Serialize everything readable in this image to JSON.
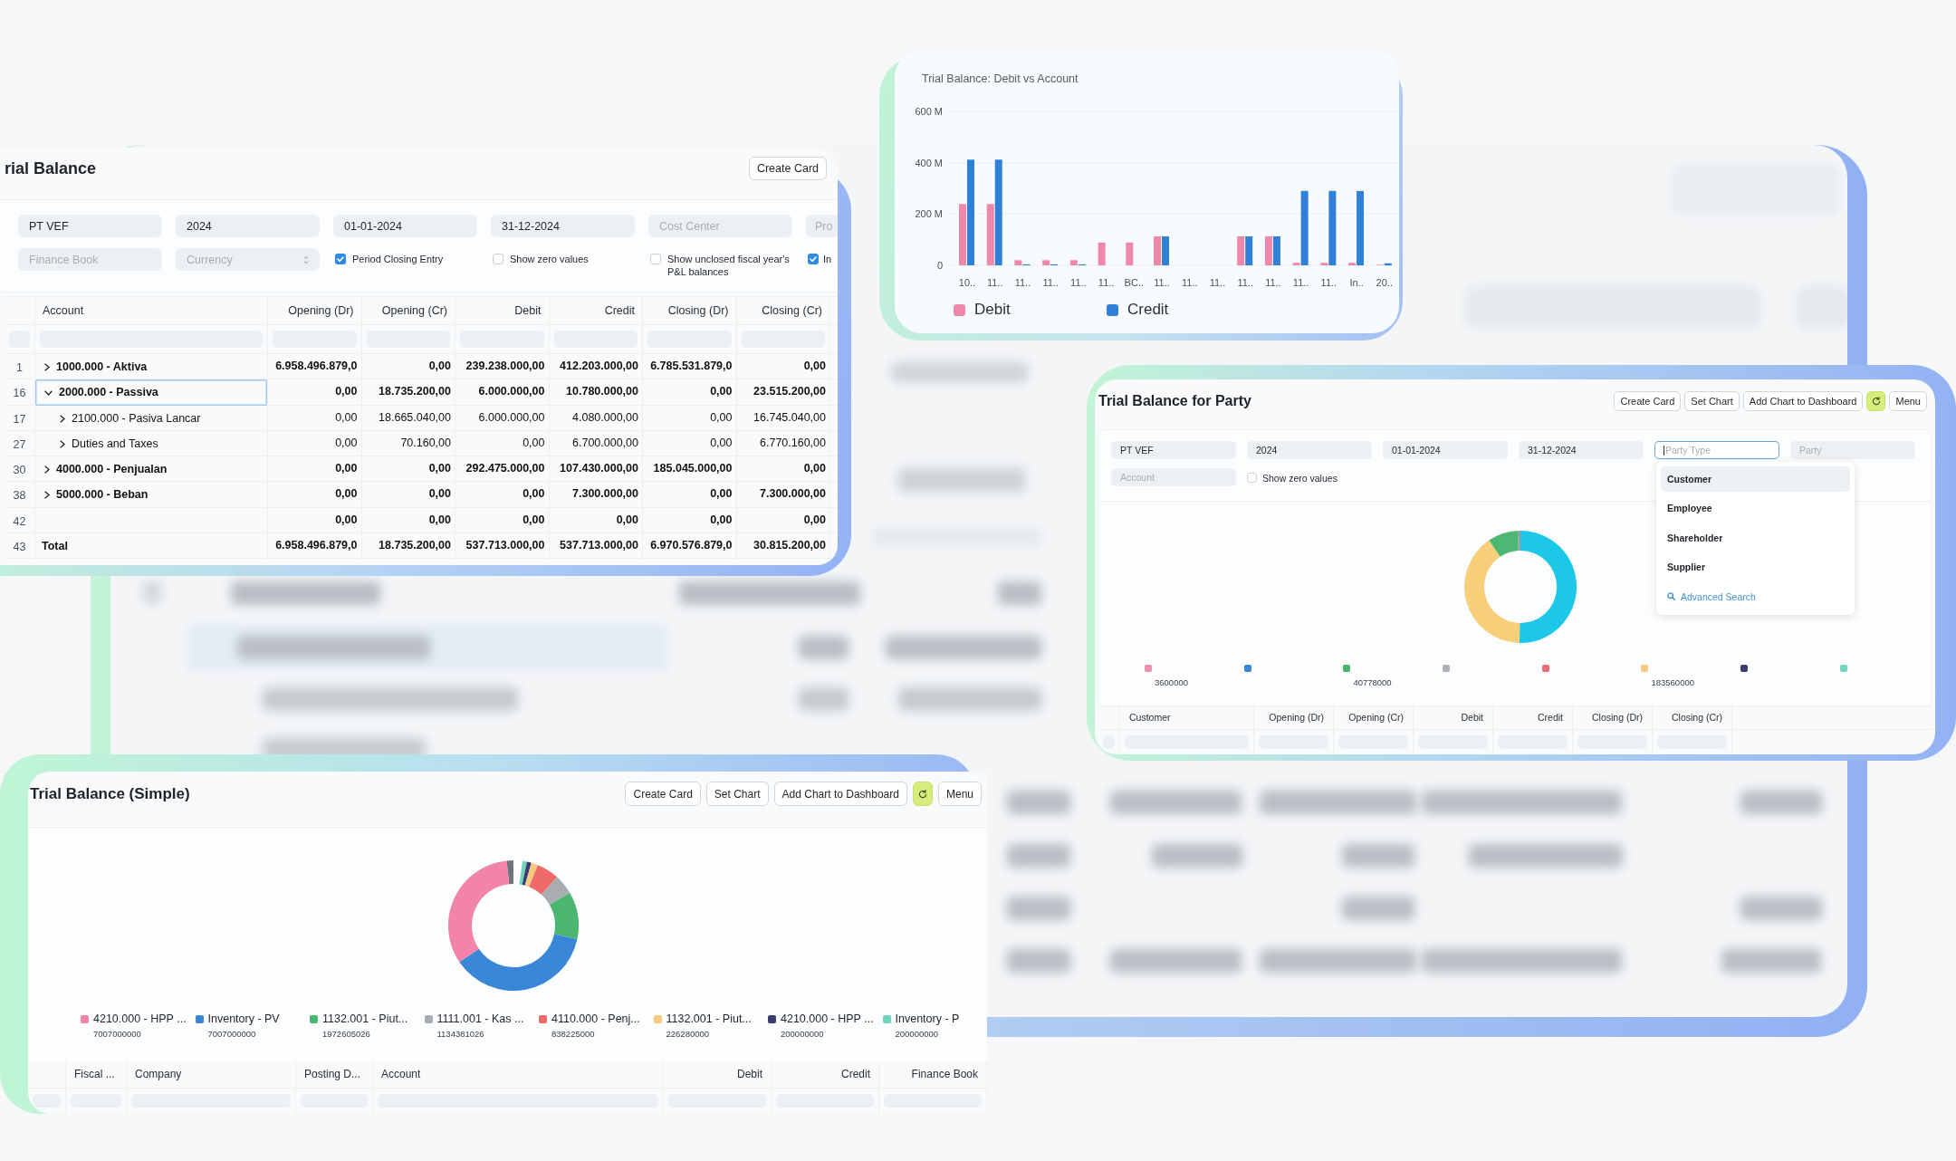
{
  "trial_balance": {
    "title": "rial Balance",
    "buttons": [
      {
        "kind": "text",
        "label": "Create Card"
      }
    ],
    "filters": [
      {
        "kind": "input",
        "value": "PT VEF"
      },
      {
        "kind": "input",
        "value": "2024"
      },
      {
        "kind": "input",
        "value": "01-01-2024"
      },
      {
        "kind": "input",
        "value": "31-12-2024"
      },
      {
        "kind": "input",
        "placeholder": "Cost Center"
      },
      {
        "kind": "input",
        "placeholder": "Pro"
      },
      {
        "kind": "input",
        "placeholder": "Finance Book"
      },
      {
        "kind": "select",
        "placeholder": "Currency"
      },
      {
        "kind": "checkbox",
        "label": "Period Closing Entry",
        "checked": true
      },
      {
        "kind": "checkbox",
        "label": "Show zero values",
        "checked": false
      },
      {
        "kind": "checkbox",
        "label": "Show unclosed fiscal year's P&L balances",
        "checked": false
      },
      {
        "kind": "checkbox",
        "label": "In",
        "checked": true
      }
    ],
    "table": {
      "columns": [
        "Account",
        "Opening (Dr)",
        "Opening (Cr)",
        "Debit",
        "Credit",
        "Closing (Dr)",
        "Closing (Cr)"
      ],
      "rows": [
        {
          "kind": "group",
          "number": "1",
          "account": "1000.000 - Aktiva",
          "expanded": false,
          "selected": false,
          "values": [
            "6.958.496.879,0",
            "0,00",
            "239.238.000,00",
            "412.203.000,00",
            "6.785.531.879,0",
            "0,00"
          ]
        },
        {
          "kind": "group",
          "number": "16",
          "account": "2000.000 - Passiva",
          "expanded": true,
          "selected": true,
          "values": [
            "0,00",
            "18.735.200,00",
            "6.000.000,00",
            "10.780.000,00",
            "0,00",
            "23.515.200,00"
          ],
          "children": [
            {
              "kind": "group",
              "number": "17",
              "account": "2100.000 - Pasiva Lancar",
              "expanded": false,
              "selected": false,
              "values": [
                "0,00",
                "18.665.040,00",
                "6.000.000,00",
                "4.080.000,00",
                "0,00",
                "16.745.040,00"
              ]
            },
            {
              "kind": "group",
              "number": "27",
              "account": "Duties and Taxes",
              "expanded": false,
              "selected": false,
              "values": [
                "0,00",
                "70.160,00",
                "0,00",
                "6.700.000,00",
                "0,00",
                "6.770.160,00"
              ]
            }
          ]
        },
        {
          "kind": "group",
          "number": "30",
          "account": "4000.000 - Penjualan",
          "expanded": false,
          "selected": false,
          "values": [
            "0,00",
            "0,00",
            "292.475.000,00",
            "107.430.000,00",
            "185.045.000,00",
            "0,00"
          ]
        },
        {
          "kind": "group",
          "number": "38",
          "account": "5000.000 - Beban",
          "expanded": false,
          "selected": false,
          "values": [
            "0,00",
            "0,00",
            "0,00",
            "7.300.000,00",
            "0,00",
            "7.300.000,00"
          ]
        },
        {
          "kind": "plain",
          "number": "42",
          "selected": false,
          "values": [
            "0,00",
            "0,00",
            "0,00",
            "0,00",
            "0,00",
            "0,00"
          ]
        },
        {
          "kind": "total",
          "number": "43",
          "account": "Total",
          "selected": false,
          "values": [
            "6.958.496.879,0",
            "18.735.200,00",
            "537.713.000,00",
            "537.713.000,00",
            "6.970.576.879,0",
            "30.815.200,00"
          ]
        }
      ]
    }
  },
  "debit_chart": {
    "chart_data": {
      "type": "bar",
      "title": "Trial Balance: Debit vs Account",
      "categories": [
        "10..",
        "11..",
        "11..",
        "11..",
        "11..",
        "11..",
        "BC..",
        "11..",
        "11..",
        "11..",
        "11..",
        "11..",
        "11..",
        "11..",
        "In..",
        "20.."
      ],
      "series": [
        {
          "name": "Debit",
          "color": "#ef87ab",
          "values": [
            239,
            239,
            20,
            20,
            20,
            89,
            89,
            113,
            0,
            0,
            113,
            113,
            10,
            10,
            10,
            2
          ]
        },
        {
          "name": "Credit",
          "color": "#2f80d6",
          "values": [
            412,
            412,
            4,
            4,
            4,
            0,
            0,
            113,
            0,
            0,
            113,
            113,
            290,
            290,
            290,
            8
          ]
        }
      ],
      "ylim": [
        0,
        600
      ],
      "yticks": [
        {
          "value": 0,
          "label": "0"
        },
        {
          "value": 200,
          "label": "200 M"
        },
        {
          "value": 400,
          "label": "400 M"
        },
        {
          "value": 600,
          "label": "600 M"
        }
      ]
    }
  },
  "party_report": {
    "title": "Trial Balance for Party",
    "buttons": [
      {
        "kind": "text",
        "label": "Create Card"
      },
      {
        "kind": "text",
        "label": "Set Chart"
      },
      {
        "kind": "text",
        "label": "Add Chart to Dashboard"
      },
      {
        "kind": "refresh"
      },
      {
        "kind": "text",
        "label": "Menu"
      }
    ],
    "filters": [
      {
        "kind": "input",
        "value": "PT VEF",
        "focused": false
      },
      {
        "kind": "input",
        "value": "2024",
        "focused": false
      },
      {
        "kind": "input",
        "value": "01-01-2024",
        "focused": false
      },
      {
        "kind": "input",
        "value": "31-12-2024",
        "focused": false
      },
      {
        "kind": "input",
        "placeholder": "Party Type",
        "focused": true
      },
      {
        "kind": "input",
        "placeholder": "Party",
        "focused": false
      },
      {
        "kind": "input",
        "placeholder": "Account",
        "focused": false
      },
      {
        "kind": "checkbox",
        "label": "Show zero values",
        "checked": false
      }
    ],
    "dropdown": {
      "options": [
        {
          "label": "Customer",
          "selected": true
        },
        {
          "label": "Employee",
          "selected": false
        },
        {
          "label": "Shareholder",
          "selected": false
        },
        {
          "label": "Supplier",
          "selected": false
        }
      ],
      "link": "Advanced Search"
    },
    "legend": [
      {
        "color": "#f08db0",
        "value": "3600000"
      },
      {
        "color": "#3a87d4"
      },
      {
        "color": "#4bb56e",
        "value": "40778000"
      },
      {
        "color": "#aeb2b7"
      },
      {
        "color": "#ea6d73"
      },
      {
        "color": "#f5c97e",
        "value": "183560000"
      },
      {
        "color": "#3d3f73"
      },
      {
        "color": "#72d8c0"
      }
    ],
    "table": {
      "columns": [
        "Customer",
        "Opening (Dr)",
        "Opening (Cr)",
        "Debit",
        "Credit",
        "Closing (Dr)",
        "Closing (Cr)"
      ]
    }
  },
  "simple_report": {
    "title": "Trial Balance (Simple)",
    "buttons": [
      {
        "kind": "text",
        "label": "Create Card"
      },
      {
        "kind": "text",
        "label": "Set Chart"
      },
      {
        "kind": "text",
        "label": "Add Chart to Dashboard"
      },
      {
        "kind": "refresh"
      },
      {
        "kind": "text",
        "label": "Menu"
      }
    ],
    "legend": [
      {
        "label": "4210.000 - HPP ...",
        "value": "7007000000",
        "color": "#f283ab"
      },
      {
        "label": "Inventory - PV",
        "value": "7007000000",
        "color": "#3a87d8"
      },
      {
        "label": "1132.001 - Piut...",
        "value": "1972605026",
        "color": "#4ab66f"
      },
      {
        "label": "1111.001 - Kas ...",
        "value": "1134381026",
        "color": "#a8adb2"
      },
      {
        "label": "4110.000 - Penj...",
        "value": "838225000",
        "color": "#ee6a6a"
      },
      {
        "label": "1132.001 - Piut...",
        "value": "226280000",
        "color": "#f6c97c"
      },
      {
        "label": "4210.000 - HPP ...",
        "value": "200000000",
        "color": "#3b3e72"
      },
      {
        "label": "Inventory - P",
        "value": "200000000",
        "color": "#6fd5bf"
      }
    ],
    "table": {
      "columns": [
        "Fiscal ...",
        "Company",
        "Posting D...",
        "Account",
        "Debit",
        "Credit",
        "Finance Book"
      ]
    }
  }
}
